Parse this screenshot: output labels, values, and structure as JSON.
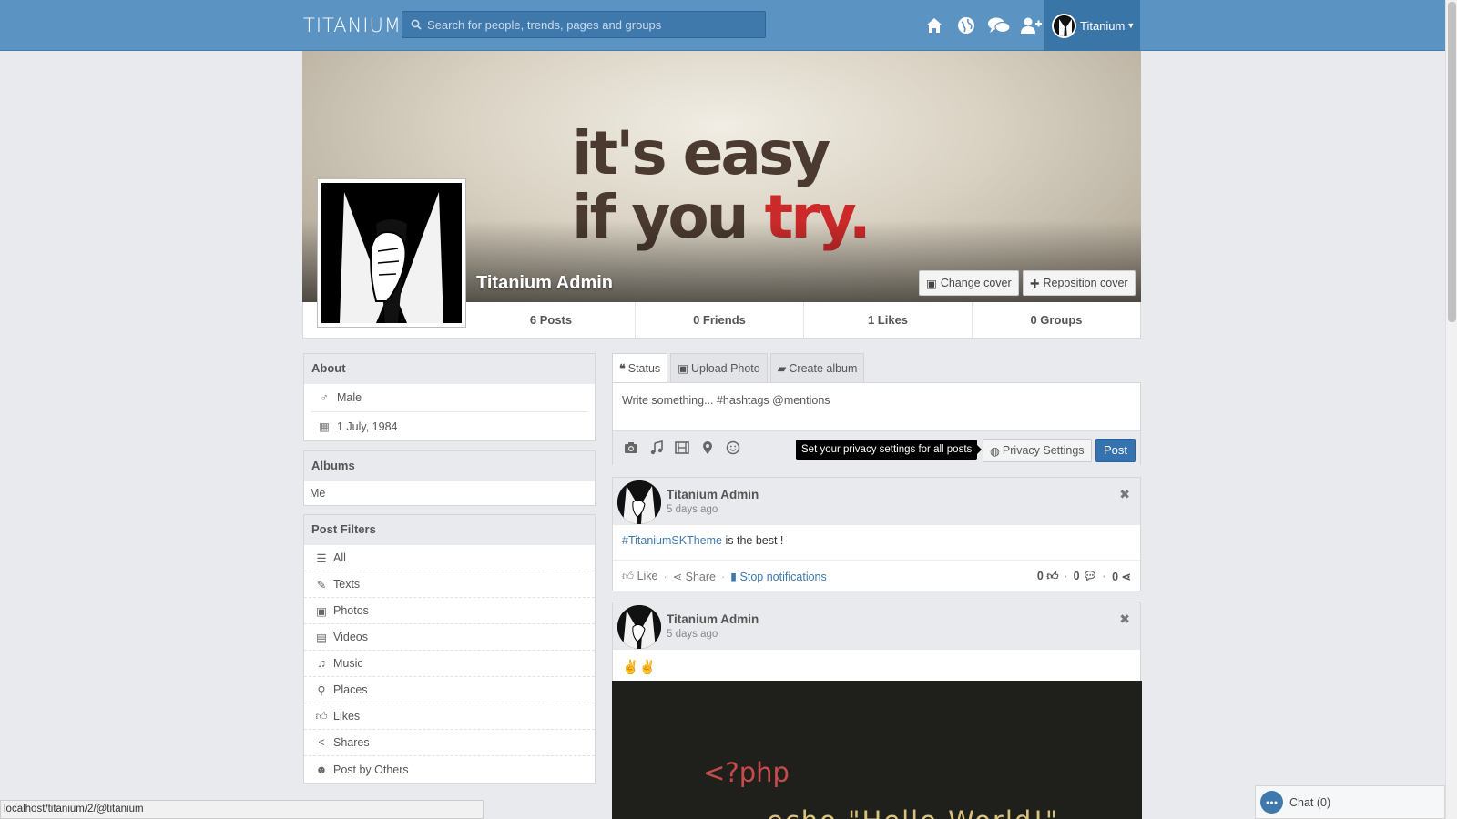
{
  "header": {
    "logo": "TITANIUM",
    "search_placeholder": "Search for people, trends, pages and groups",
    "nav_icons": [
      "home-icon",
      "globe-icon",
      "messages-icon",
      "add-friend-icon"
    ],
    "user_menu_label": "Titanium"
  },
  "profile": {
    "cover_text_line1": "it's easy",
    "cover_text_line2_a": "if you ",
    "cover_text_line2_b": "try.",
    "name": "Titanium Admin",
    "change_cover": "Change cover",
    "reposition_cover": "Reposition cover"
  },
  "stats": {
    "posts": "6 Posts",
    "friends": "0 Friends",
    "likes": "1 Likes",
    "groups": "0 Groups"
  },
  "about": {
    "title": "About",
    "gender": "Male",
    "birthday": "1 July, 1984"
  },
  "albums": {
    "title": "Albums",
    "items": [
      "Me"
    ]
  },
  "filters": {
    "title": "Post Filters",
    "items": [
      "All",
      "Texts",
      "Photos",
      "Videos",
      "Music",
      "Places",
      "Likes",
      "Shares",
      "Post by Others"
    ]
  },
  "publisher": {
    "tabs": [
      "Status",
      "Upload Photo",
      "Create album"
    ],
    "placeholder": "Write something... #hashtags @mentions",
    "tooltip": "Set your privacy settings for all posts",
    "privacy_button": "Privacy Settings",
    "post_button": "Post"
  },
  "stories": [
    {
      "author": "Titanium Admin",
      "time": "5 days ago",
      "hashtag": "#TitaniumSKTheme",
      "text": " is the best !",
      "like": "Like",
      "share": "Share",
      "stop": "Stop notifications",
      "likes_count": "0",
      "comments_count": "0",
      "shares_count": "0"
    },
    {
      "author": "Titanium Admin",
      "time": "5 days ago",
      "emoji": "✌✌",
      "image_code_line1": "<?php",
      "image_code_line2": "echo \"Hello World!\""
    }
  ],
  "statusbar": "localhost/titanium/2/@titanium",
  "chat": "Chat (0)"
}
